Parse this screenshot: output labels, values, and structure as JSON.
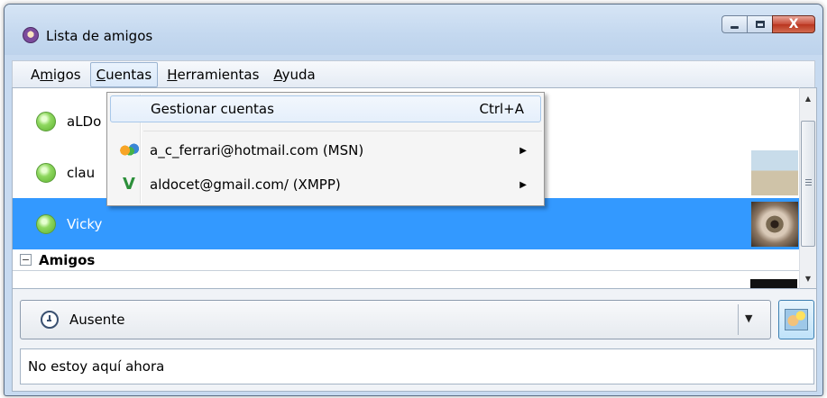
{
  "window": {
    "title": "Lista de amigos",
    "app_icon": "pidgin-icon",
    "controls": {
      "minimize": "minimize-icon",
      "maximize": "maximize-icon",
      "close": "X"
    }
  },
  "menubar": {
    "items": [
      {
        "label": "Amigos",
        "underline_index": 1
      },
      {
        "label": "Cuentas",
        "underline_index": 0
      },
      {
        "label": "Herramientas",
        "underline_index": 0
      },
      {
        "label": "Ayuda",
        "underline_index": 0
      }
    ],
    "active": "Cuentas"
  },
  "buddies": [
    {
      "name": "aLDo",
      "status": "available",
      "avatar": null
    },
    {
      "name": "clau",
      "status": "available",
      "avatar": "pyramid-photo"
    },
    {
      "name": "Vicky",
      "status": "available",
      "avatar": "eye-photo",
      "selected": true
    }
  ],
  "group": {
    "label": "Amigos",
    "expanded": true
  },
  "dropdown": {
    "items": [
      {
        "label": "Gestionar cuentas",
        "shortcut": "Ctrl+A",
        "icon": null,
        "submenu": false
      },
      {
        "label": "a_c_ferrari@hotmail.com (MSN)",
        "shortcut": "",
        "icon": "msn-butterfly-icon",
        "submenu": true
      },
      {
        "label": "aldocet@gmail.com/ (XMPP)",
        "shortcut": "",
        "icon": "xmpp-icon",
        "submenu": true
      }
    ]
  },
  "status_selector": {
    "value": "Ausente",
    "icon": "clock-icon",
    "arrow": "▼"
  },
  "status_message": "No estoy aquí ahora",
  "glyphs": {
    "minimize": "",
    "close": "X",
    "scroll_up": "▲",
    "scroll_down": "▼",
    "submenu_arrow": "▶",
    "expand": "−",
    "xmpp": "V"
  },
  "colors": {
    "selection": "#3399ff",
    "status_available": "#6cc23a",
    "titlebar": "#c4d8ef",
    "close_button": "#c74b37"
  }
}
